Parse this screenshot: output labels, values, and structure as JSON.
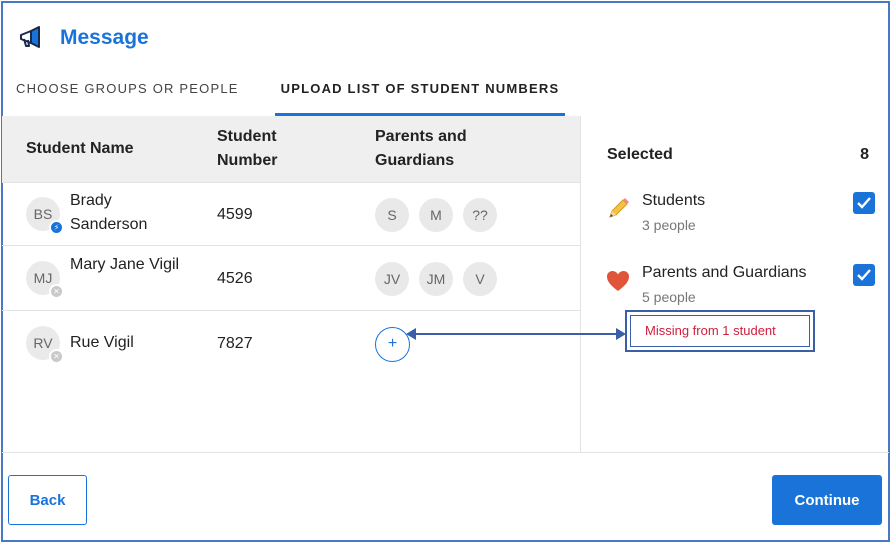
{
  "header": {
    "title": "Message",
    "icon": "megaphone-icon"
  },
  "tabs": [
    {
      "label": "CHOOSE GROUPS OR PEOPLE",
      "active": false
    },
    {
      "label": "UPLOAD LIST OF STUDENT NUMBERS",
      "active": true
    }
  ],
  "table": {
    "columns": [
      "Student Name",
      "Student Number",
      "Parents and Guardians"
    ],
    "rows": [
      {
        "initials": "BS",
        "name": "Brady Sanderson",
        "number": "4599",
        "badge": "blue",
        "guardians": [
          "S",
          "M",
          "??"
        ]
      },
      {
        "initials": "MJ",
        "name": "Mary Jane Vigil",
        "number": "4526",
        "badge": "gray",
        "guardians": [
          "JV",
          "JM",
          "V"
        ]
      },
      {
        "initials": "RV",
        "name": "Rue Vigil",
        "number": "7827",
        "badge": "gray",
        "guardians": [],
        "add_label": "+"
      }
    ]
  },
  "selected": {
    "title": "Selected",
    "count": "8",
    "groups": [
      {
        "label": "Students",
        "sub": "3 people",
        "checked": true,
        "icon": "pencil-icon"
      },
      {
        "label": "Parents and Guardians",
        "sub": "5 people",
        "checked": true,
        "icon": "heart-icon"
      }
    ],
    "warning": "Missing from 1 student"
  },
  "footer": {
    "back_label": "Back",
    "continue_label": "Continue"
  },
  "colors": {
    "accent": "#1a73d9",
    "warning": "#d01f3c",
    "annotation": "#3a5ea8"
  }
}
